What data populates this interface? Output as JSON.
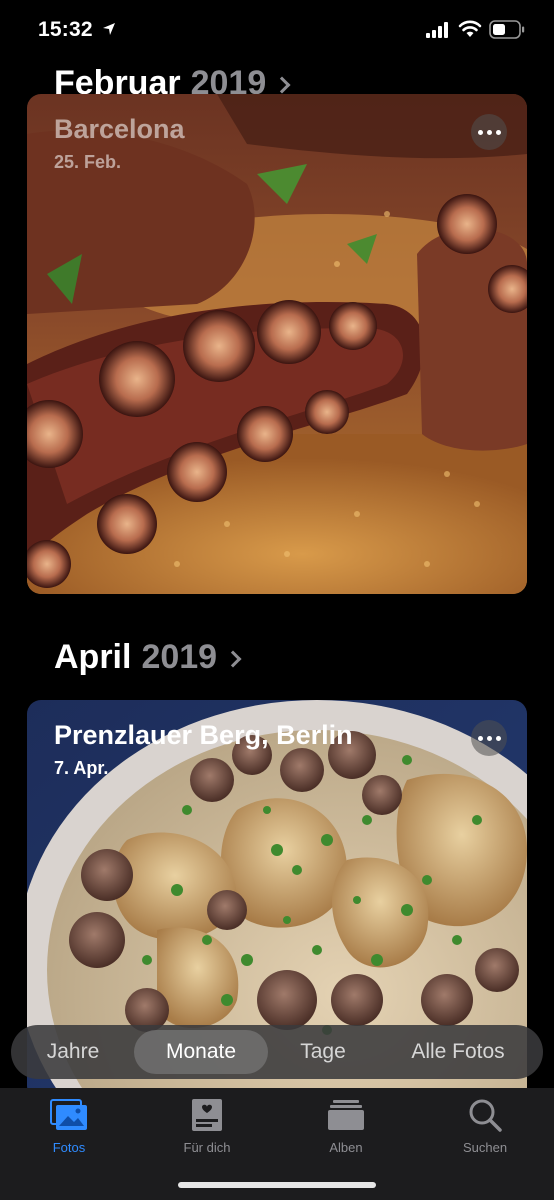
{
  "status_bar": {
    "time": "15:32"
  },
  "sections": [
    {
      "month": "Februar",
      "year": "2019",
      "card": {
        "title": "Barcelona",
        "date": "25. Feb."
      }
    },
    {
      "month": "April",
      "year": "2019",
      "card": {
        "title": "Prenzlauer Berg, Berlin",
        "date": "7. Apr."
      }
    }
  ],
  "segmented": {
    "options": [
      "Jahre",
      "Monate",
      "Tage",
      "Alle Fotos"
    ],
    "selected": "Monate"
  },
  "tabbar": {
    "tabs": [
      {
        "label": "Fotos",
        "icon": "photos-icon"
      },
      {
        "label": "Für dich",
        "icon": "for-you-icon"
      },
      {
        "label": "Alben",
        "icon": "albums-icon"
      },
      {
        "label": "Suchen",
        "icon": "search-icon"
      }
    ],
    "active": "Fotos"
  },
  "colors": {
    "accent": "#2f8bff",
    "background": "#000000",
    "secondary_text": "#8e8e93"
  }
}
